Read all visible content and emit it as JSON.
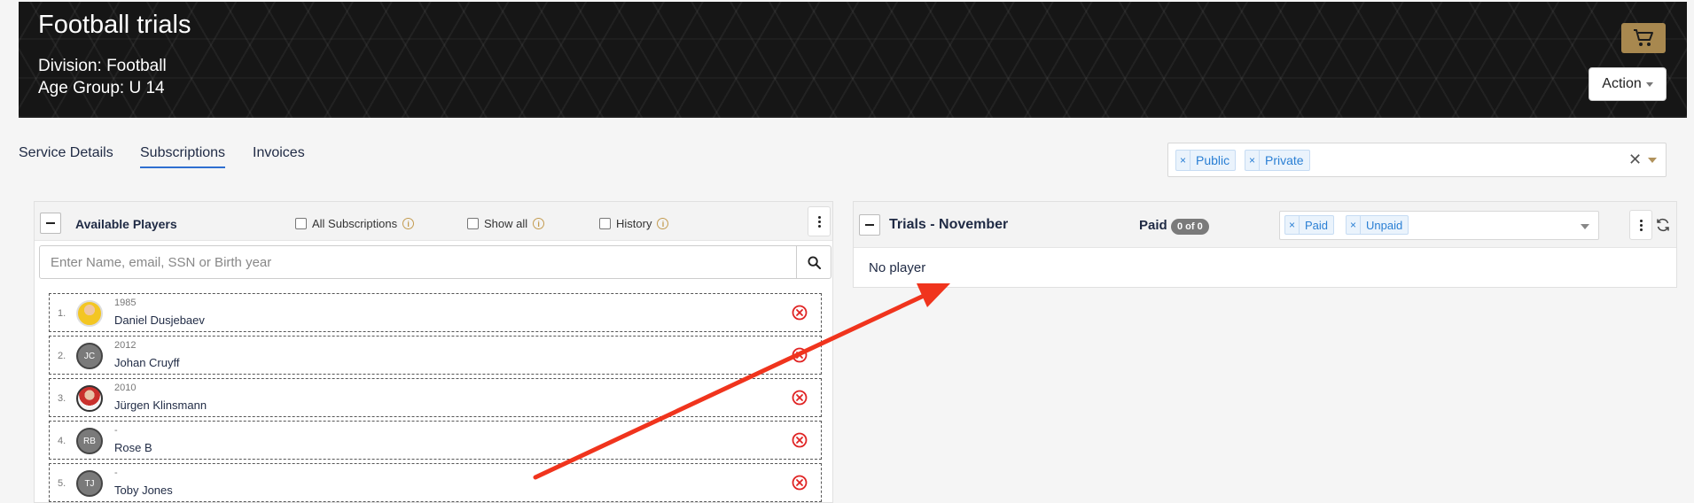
{
  "header": {
    "title": "Football trials",
    "division": "Division: Football",
    "age_group": "Age Group: U 14",
    "cart_icon": "cart-icon",
    "action_label": "Action"
  },
  "tabs": [
    {
      "label": "Service Details",
      "active": false
    },
    {
      "label": "Subscriptions",
      "active": true
    },
    {
      "label": "Invoices",
      "active": false
    }
  ],
  "visibility_filter": {
    "chips": [
      {
        "label": "Public"
      },
      {
        "label": "Private"
      }
    ],
    "remove_glyph": "×",
    "clear_glyph": "✕"
  },
  "available_players": {
    "title": "Available Players",
    "checkboxes": [
      {
        "label": "All Subscriptions",
        "checked": false
      },
      {
        "label": "Show all",
        "checked": false
      },
      {
        "label": "History",
        "checked": false
      }
    ],
    "info_glyph": "i",
    "search_placeholder": "Enter Name, email, SSN or Birth year",
    "players": [
      {
        "num": "1.",
        "year": "1985",
        "name": "Daniel Dusjebaev",
        "initials": "",
        "avatar": "photo-yellow"
      },
      {
        "num": "2.",
        "year": "2012",
        "name": "Johan Cruyff",
        "initials": "JC",
        "avatar": "initials"
      },
      {
        "num": "3.",
        "year": "2010",
        "name": "Jürgen Klinsmann",
        "initials": "",
        "avatar": "photo-red"
      },
      {
        "num": "4.",
        "year": "-",
        "name": "Rose B",
        "initials": "RB",
        "avatar": "initials"
      },
      {
        "num": "5.",
        "year": "-",
        "name": "Toby Jones",
        "initials": "TJ",
        "avatar": "initials"
      }
    ]
  },
  "trials_panel": {
    "title": "Trials - November",
    "paid_label": "Paid",
    "paid_badge": "0 of 0",
    "status_chips": [
      {
        "label": "Paid"
      },
      {
        "label": "Unpaid"
      }
    ],
    "empty_text": "No player"
  },
  "colors": {
    "accent": "#2f6fd0",
    "cart_button": "#a8884f",
    "remove_icon": "#e02424",
    "annotation_arrow": "#f0341d"
  }
}
